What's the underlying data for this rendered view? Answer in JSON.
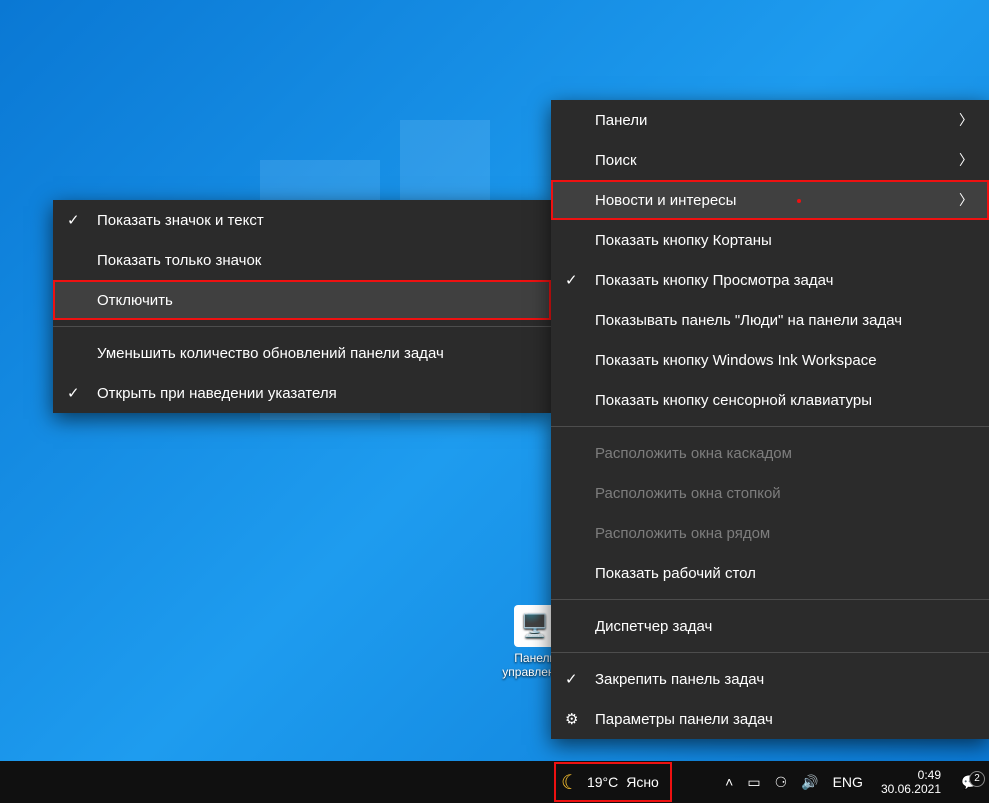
{
  "desktop": {
    "icon_label": "Панель управления"
  },
  "submenu": {
    "items": [
      {
        "label": "Показать значок и текст",
        "checked": true
      },
      {
        "label": "Показать только значок",
        "checked": false
      },
      {
        "label": "Отключить",
        "checked": false,
        "highlight": true,
        "hover": true
      }
    ],
    "extra": [
      {
        "label": "Уменьшить количество обновлений панели задач",
        "checked": false
      },
      {
        "label": "Открыть при наведении указателя",
        "checked": true
      }
    ]
  },
  "mainmenu": {
    "groups": [
      [
        {
          "label": "Панели",
          "arrow": true
        },
        {
          "label": "Поиск",
          "arrow": true
        },
        {
          "label": "Новости и интересы",
          "arrow": true,
          "highlight": true,
          "hover": true
        },
        {
          "label": "Показать кнопку Кортаны"
        },
        {
          "label": "Показать кнопку Просмотра задач",
          "checked": true
        },
        {
          "label": "Показывать панель \"Люди\" на панели задач"
        },
        {
          "label": "Показать кнопку Windows Ink Workspace"
        },
        {
          "label": "Показать кнопку сенсорной клавиатуры"
        }
      ],
      [
        {
          "label": "Расположить окна каскадом",
          "disabled": true
        },
        {
          "label": "Расположить окна стопкой",
          "disabled": true
        },
        {
          "label": "Расположить окна рядом",
          "disabled": true
        },
        {
          "label": "Показать рабочий стол"
        }
      ],
      [
        {
          "label": "Диспетчер задач"
        }
      ],
      [
        {
          "label": "Закрепить панель задач",
          "checked": true
        },
        {
          "label": "Параметры панели задач",
          "gear": true
        }
      ]
    ]
  },
  "taskbar": {
    "weather_temp": "19°C",
    "weather_cond": "Ясно",
    "lang": "ENG",
    "time": "0:49",
    "date": "30.06.2021",
    "notif_count": "2"
  }
}
